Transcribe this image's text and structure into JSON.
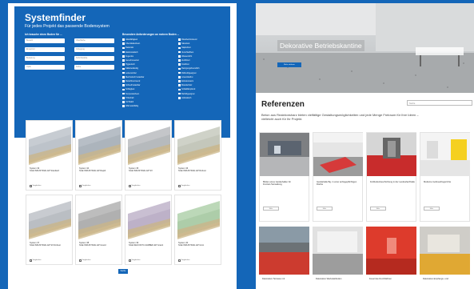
{
  "left": {
    "title": "Systemfinder",
    "subtitle": "Für jedes Projekt das passende Bodensystem",
    "filter_label": "Ich brauche einen Boden für ...",
    "requirements_label": "Besondere Anforderungen an meinen Boden ...",
    "selects_left": [
      "Bereich",
      "Einsatzort",
      "Belastung",
      "Optik"
    ],
    "selects_mid": [
      "Oberfläche",
      "Verlegung",
      "Schichtstärke",
      "Farbe"
    ],
    "checks_col1": [
      "Ableitfähigkeit",
      "Chemikalienbest.",
      "Dekorativ",
      "Elektrostatisch",
      "Fugenlos",
      "Geruchsneutral",
      "Hygienisch",
      "Kältebeständig",
      "Lebensmittel",
      "Mechanisch belastbar",
      "Rutschhemmend",
      "Schnell belastbar",
      "Schlagfest",
      "Temperaturbest.",
      "Trittschall",
      "UV-Stabil",
      "Wärmeleitfähig"
    ],
    "checks_col2": [
      "Rissüberbrückend",
      "Säurefest",
      "Staplerfest",
      "Verschleißfest",
      "Wasserdicht",
      "Zertifiziert",
      "Kratzfest",
      "Reinigungsfreundlich",
      "Rollstuhlgeeignet",
      "Lösemittelfrei",
      "Emissionsarm",
      "Brandschutz",
      "Schalldämpfend",
      "Barfußgeeignet",
      "Antistatisch"
    ],
    "products": [
      {
        "title": "System 33\nSGE INDUSTRIAL EP Standard",
        "compare": "Vergleichen",
        "colors": [
          "#c7ccd2",
          "#b5bcc4"
        ]
      },
      {
        "title": "System 34\nSGE INDUSTRIAL EP Rapid",
        "compare": "Vergleichen",
        "colors": [
          "#b7bec6",
          "#a5adb6"
        ]
      },
      {
        "title": "System 35\nSGE INDUSTRIAL EP SX",
        "compare": "Vergleichen",
        "colors": [
          "#c4c6c9",
          "#aeb2b6"
        ]
      },
      {
        "title": "System 36\nSGE INDUSTRIAL EP Robust",
        "compare": "Vergleichen",
        "colors": [
          "#cfd2c8",
          "#bcbfb2"
        ]
      },
      {
        "title": "System 37\nSGE INDUSTRIAL EP SX Robust",
        "compare": "Vergleichen",
        "colors": [
          "#c8cbd0",
          "#b0b5bb"
        ]
      },
      {
        "title": "System 38\nSGE INDUSTRIAL EP Grand",
        "compare": "Vergleichen",
        "colors": [
          "#bdbdbd",
          "#a6a6a6"
        ]
      },
      {
        "title": "System 39\nSGE DECOR PU-FARBEN EP Granit",
        "compare": "Vergleichen",
        "colors": [
          "#c9bfd2",
          "#b5a9c2"
        ]
      },
      {
        "title": "System 40\nSGE INDUSTRIAL EP Grün",
        "compare": "Vergleichen",
        "colors": [
          "#bcd8b8",
          "#a4c79f"
        ]
      }
    ],
    "button": "Suche"
  },
  "right": {
    "hero_title": "Dekorative Betriebskantine",
    "hero_button": "Mehr erfahren",
    "ref_title": "Referenzen",
    "ref_text": "Beton aus Reaktionsharz bieten vielfältige Gestaltungsmöglichkeiten und jede Menge Freiraum für Ihre Ideen – vielleicht auch für Ihr Projekt.",
    "search_placeholder": "Suche",
    "references": [
      {
        "title": "Böden eines Gerätehallen für Freizeit-/Verwaltung",
        "more": "Mehr"
      },
      {
        "title": "Gerätehalle Bg. in einer anfragepflichtigen Fläche",
        "more": "Mehr"
      },
      {
        "title": "Fußbodenbeschichtung in der Landesfachhalle",
        "more": "Mehr"
      },
      {
        "title": "Moderne Gebrauchsgerichte",
        "more": "Mehr"
      }
    ],
    "bottom_refs": [
      "Dekorative Terrasse mit",
      "Dekorative Werkstattboden",
      "Feuerrote Durchfahrten",
      "Dekorative Empfangs- und"
    ]
  }
}
